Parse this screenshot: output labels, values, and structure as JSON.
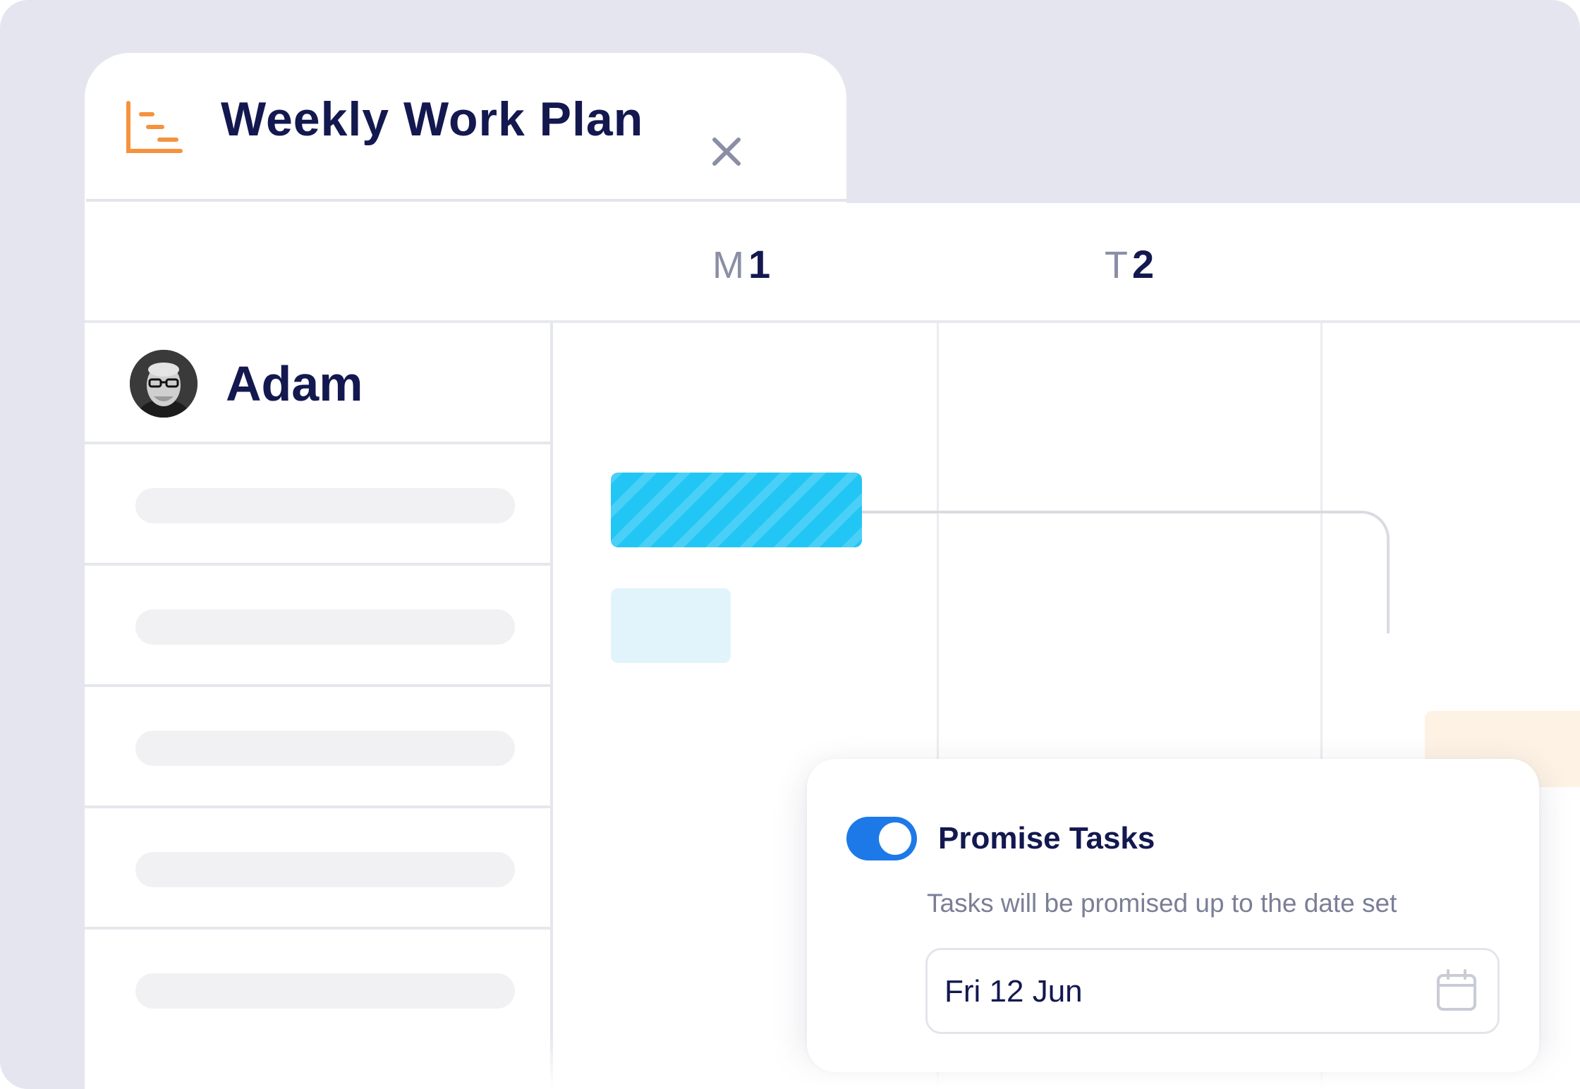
{
  "colors": {
    "background": "#e4e5ee",
    "title": "#13184f",
    "accent_orange": "#f5923e",
    "task_blue": "#22c6f5",
    "toggle_blue": "#1e79e8"
  },
  "tab": {
    "icon": "timeline-chart-icon",
    "title": "Weekly Work Plan",
    "close_icon": "close-icon"
  },
  "calendar": {
    "days": [
      {
        "letter": "M",
        "number": "1"
      },
      {
        "letter": "T",
        "number": "2"
      }
    ]
  },
  "person": {
    "name": "Adam",
    "avatar_icon": "avatar-photo"
  },
  "popover": {
    "toggle_on": true,
    "title": "Promise Tasks",
    "description": "Tasks will be promised up to the date set",
    "date_value": "Fri 12 Jun",
    "date_icon": "calendar-icon"
  }
}
